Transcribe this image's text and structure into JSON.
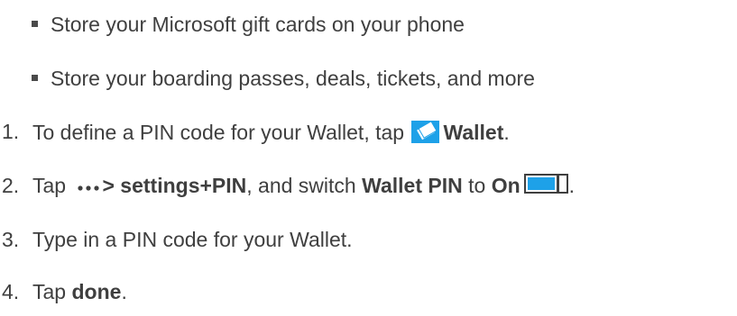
{
  "bullets": [
    {
      "text": "Store your Microsoft gift cards on your phone"
    },
    {
      "text": "Store your boarding passes, deals, tickets, and more"
    }
  ],
  "steps": [
    {
      "number": "1.",
      "text_before": "To define a PIN code for your Wallet, tap",
      "bold": "Wallet",
      "text_after": "."
    },
    {
      "number": "2.",
      "text_before": "Tap",
      "bold_menu": "> settings+PIN",
      "text_mid": ", and switch",
      "bold_setting": "Wallet PIN",
      "text_to": "to",
      "bold_on": "On",
      "text_after": "."
    },
    {
      "number": "3.",
      "text": "Type in a PIN code for your Wallet."
    },
    {
      "number": "4.",
      "text_before": "Tap",
      "bold": "done",
      "text_after": "."
    }
  ],
  "icons": {
    "wallet": "wallet-icon",
    "more": "more-dots-icon",
    "toggle": "toggle-on-icon"
  },
  "colors": {
    "text": "#3f3f3f",
    "accent": "#1ea1e8"
  }
}
